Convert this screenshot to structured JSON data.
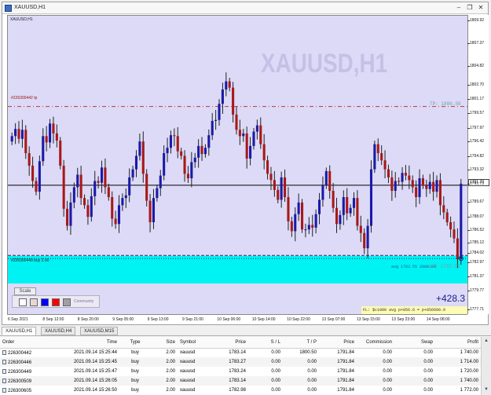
{
  "window": {
    "title": "XAUUSD,H1",
    "chart_label": "XAUUSD,H1",
    "watermark": "XAUUSD,H1"
  },
  "chart": {
    "tp_label": "TP: 1800.50",
    "order_label_top": "#226300442 tp",
    "order_label_bottom": "#226300449 buy 2.00",
    "avg_label": "avg 1783.55 2800.00",
    "avt_label": "AVT 1783.55",
    "scale_button": "Scale",
    "community_label": "Community",
    "profit_big": "+428.3",
    "status_text": "FL: $c1000 avg p+856.6 = p+856600.0",
    "current_price": "1791.73",
    "colors": {
      "plot_bg": "#dcdaf7",
      "band": "#00f3f3",
      "bull": "#1a1aa6",
      "bear": "#a81818",
      "tp_line": "#c03838"
    },
    "swatches": [
      "#ffffff",
      "#e8d6d6",
      "#0000ff",
      "#ff0000",
      "#a0a0a0",
      "#d8d8e8"
    ]
  },
  "chart_data": {
    "type": "candlestick",
    "symbol": "XAUUSD",
    "timeframe": "H1",
    "y_ticks": [
      "1809.92",
      "1807.37",
      "1804.82",
      "1802.70",
      "1801.17",
      "1799.57",
      "1797.97",
      "1796.42",
      "1794.82",
      "1793.32",
      "1791.73",
      "1789.67",
      "1788.07",
      "1786.52",
      "1785.12",
      "1784.02",
      "1782.97",
      "1781.37",
      "1779.77",
      "1777.71"
    ],
    "x_ticks": [
      "6 Sep 2021",
      "8 Sep 12:00",
      "8 Sep 20:00",
      "9 Sep 05:00",
      "9 Sep 13:00",
      "9 Sep 21:00",
      "10 Sep 06:00",
      "10 Sep 14:00",
      "10 Sep 22:00",
      "13 Sep 07:00",
      "13 Sep 15:00",
      "13 Sep 23:00",
      "14 Sep 08:00"
    ],
    "ylim": [
      1777.71,
      1809.92
    ],
    "current_price": 1791.73,
    "tp": 1800.5,
    "avg_price": 1783.55,
    "closes": [
      1797.2,
      1798.0,
      1796.9,
      1797.9,
      1795.3,
      1793.9,
      1792.2,
      1791.0,
      1794.4,
      1797.2,
      1796.5,
      1798.6,
      1797.5,
      1796.7,
      1793.9,
      1789.1,
      1787.2,
      1789.8,
      1791.5,
      1792.9,
      1790.3,
      1789.5,
      1788.2,
      1790.5,
      1792.2,
      1792.0,
      1793.7,
      1791.5,
      1790.4,
      1788.0,
      1787.4,
      1789.5,
      1790.3,
      1790.6,
      1792.6,
      1793.5,
      1795.0,
      1796.6,
      1793.0,
      1790.0,
      1787.6,
      1790.3,
      1791.4,
      1792.8,
      1795.3,
      1795.9,
      1797.3,
      1797.2,
      1795.5,
      1795.0,
      1793.0,
      1792.5,
      1794.3,
      1794.8,
      1796.1,
      1795.2,
      1795.9,
      1797.3,
      1798.9,
      1799.0,
      1800.8,
      1802.4,
      1803.3,
      1802.6,
      1799.6,
      1797.9,
      1797.2,
      1797.5,
      1794.7,
      1796.1,
      1797.7,
      1798.4,
      1796.3,
      1794.5,
      1793.0,
      1792.3,
      1791.2,
      1790.1,
      1792.6,
      1790.4,
      1787.7,
      1786.6,
      1788.5,
      1789.8,
      1786.8,
      1786.8,
      1787.3,
      1787.0,
      1788.5,
      1790.1,
      1791.7,
      1793.3,
      1791.1,
      1789.2,
      1787.4,
      1788.4,
      1790.4,
      1788.6,
      1789.2,
      1790.3,
      1787.2,
      1786.4,
      1784.7,
      1787.2,
      1793.5,
      1796.3,
      1795.3,
      1794.5,
      1793.5,
      1792.6,
      1791.1,
      1792.2,
      1792.1,
      1793.1,
      1792.8,
      1792.3,
      1791.5,
      1790.4,
      1792.5,
      1791.7,
      1791.3,
      1792.1,
      1791.0,
      1792.3,
      1789.5,
      1788.7,
      1787.6,
      1786.8,
      1785.8,
      1783.5,
      1791.9
    ]
  },
  "tabs": [
    {
      "label": "XAUUSD,H1",
      "active": true
    },
    {
      "label": "XAUUSD,H4",
      "active": false
    },
    {
      "label": "XAUUSD,M15",
      "active": false
    }
  ],
  "table": {
    "columns": [
      "Order",
      "Time",
      "Type",
      "Size",
      "Symbol",
      "Price",
      "S / L",
      "T / P",
      "Price",
      "Commission",
      "Swap",
      "Profit"
    ],
    "rows": [
      [
        "226300442",
        "2021.09.14 15:25:44",
        "buy",
        "2.00",
        "xauusd",
        "1783.14",
        "0.00",
        "1800.50",
        "1791.84",
        "0.00",
        "0.00",
        "1 740.00"
      ],
      [
        "226300446",
        "2021.09.14 15:25:45",
        "buy",
        "2.00",
        "xauusd",
        "1783.27",
        "0.00",
        "0.00",
        "1791.84",
        "0.00",
        "0.00",
        "1 714.00"
      ],
      [
        "226300449",
        "2021.09.14 15:25:47",
        "buy",
        "2.00",
        "xauusd",
        "1783.24",
        "0.00",
        "0.00",
        "1791.84",
        "0.00",
        "0.00",
        "1 720.00"
      ],
      [
        "226300509",
        "2021.09.14 15:26:05",
        "buy",
        "2.00",
        "xauusd",
        "1783.14",
        "0.00",
        "0.00",
        "1791.84",
        "0.00",
        "0.00",
        "1 740.00"
      ],
      [
        "226300605",
        "2021.09.14 15:26:50",
        "buy",
        "2.00",
        "xauusd",
        "1782.98",
        "0.00",
        "0.00",
        "1791.84",
        "0.00",
        "0.00",
        "1 772.00"
      ]
    ]
  }
}
